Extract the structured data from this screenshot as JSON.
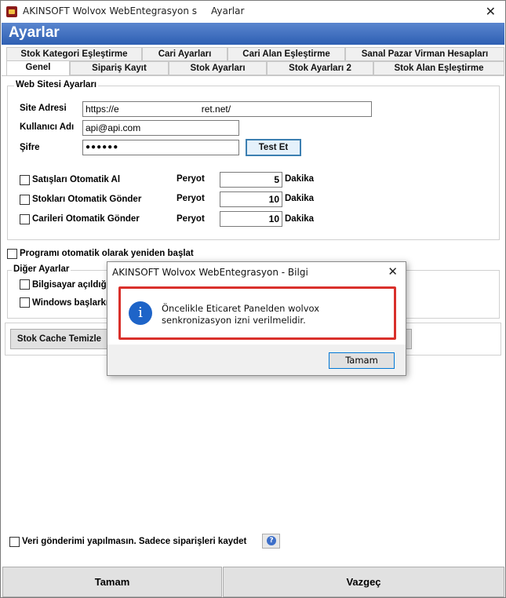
{
  "window": {
    "title_left": "AKINSOFT Wolvox WebEntegrasyon s",
    "title_right": "Ayarlar",
    "close_glyph": "✕"
  },
  "banner": {
    "title": "Ayarlar"
  },
  "tabs_row1": [
    "Stok Kategori Eşleştirme",
    "Cari Ayarları",
    "Cari Alan Eşleştirme",
    "Sanal Pazar Virman Hesapları"
  ],
  "tabs_row2": [
    "Genel",
    "Sipariş Kayıt",
    "Stok Ayarları",
    "Stok Ayarları 2",
    "Stok Alan Eşleştirme"
  ],
  "web": {
    "group_title": "Web Sitesi Ayarları",
    "site_label": "Site Adresi",
    "site_value_a": "https://e",
    "site_value_b": "ret.net/",
    "user_label": "Kullanıcı Adı",
    "user_value": "api@api.com",
    "pass_label": "Şifre",
    "pass_value": "●●●●●●",
    "test_button": "Test Et",
    "rows": [
      {
        "label": "Satışları Otomatik Al",
        "peryot": "Peryot",
        "value": "5",
        "unit": "Dakika"
      },
      {
        "label": "Stokları Otomatik Gönder",
        "peryot": "Peryot",
        "value": "10",
        "unit": "Dakika"
      },
      {
        "label": "Carileri Otomatik Gönder",
        "peryot": "Peryot",
        "value": "10",
        "unit": "Dakika"
      }
    ]
  },
  "restart_label": "Programı otomatik olarak yeniden başlat",
  "other": {
    "group_title": "Diğer Ayarlar",
    "item1": "Bilgisayar açıldığ",
    "item2": "Windows başlarkı"
  },
  "cache_button": "Stok Cache Temizle",
  "veri_label": "Veri gönderimi yapılmasın. Sadece siparişleri kaydet",
  "help_glyph": "?",
  "bottom": {
    "ok": "Tamam",
    "cancel": "Vazgeç"
  },
  "dialog": {
    "title": "AKINSOFT Wolvox WebEntegrasyon - Bilgi",
    "close_glyph": "✕",
    "info_glyph": "i",
    "message": "Öncelikle Eticaret Panelden wolvox senkronizasyon izni verilmelidir.",
    "ok": "Tamam"
  }
}
